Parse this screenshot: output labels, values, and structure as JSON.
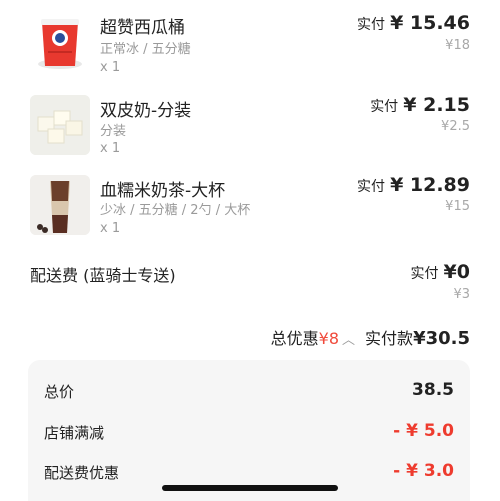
{
  "paid_label": "实付",
  "items": [
    {
      "name": "超赞西瓜桶",
      "spec": "正常冰 / 五分糖",
      "qty": "x 1",
      "paid": "¥ 15.46",
      "original": "¥18"
    },
    {
      "name": "双皮奶-分装",
      "spec": "分装",
      "qty": "x 1",
      "paid": "¥ 2.15",
      "original": "¥2.5"
    },
    {
      "name": "血糯米奶茶-大杯",
      "spec": "少冰 / 五分糖 / 2勺 / 大杯",
      "qty": "x 1",
      "paid": "¥ 12.89",
      "original": "¥15"
    }
  ],
  "delivery": {
    "label": "配送费 (蓝骑士专送)",
    "paid": "¥0",
    "original": "¥3"
  },
  "summary": {
    "discount_label": "总优惠",
    "discount_value": "¥8",
    "chevron": "︿",
    "paid_total_label": "实付款",
    "paid_total": "¥30.5"
  },
  "breakdown": [
    {
      "label": "总价",
      "value": "38.5"
    },
    {
      "label": "店铺满减",
      "value": "- ¥ 5.0"
    },
    {
      "label": "配送费优惠",
      "value": "- ¥ 3.0"
    }
  ],
  "colors": {
    "accent_red": "#ee3b2e",
    "card_bg": "#f6f6f6",
    "muted_text": "#9a9a9a"
  }
}
